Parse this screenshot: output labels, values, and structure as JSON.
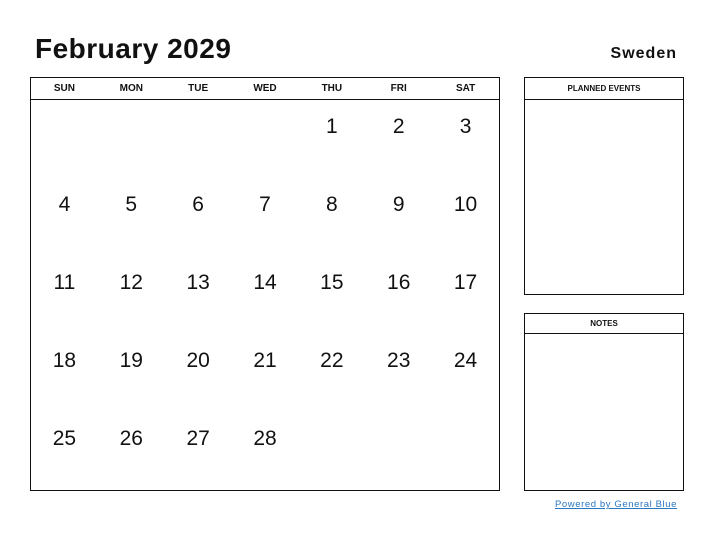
{
  "header": {
    "title": "February 2029",
    "country": "Sweden"
  },
  "calendar": {
    "weekdays": [
      "SUN",
      "MON",
      "TUE",
      "WED",
      "THU",
      "FRI",
      "SAT"
    ],
    "weeks": [
      [
        "",
        "",
        "",
        "",
        "1",
        "2",
        "3"
      ],
      [
        "4",
        "5",
        "6",
        "7",
        "8",
        "9",
        "10"
      ],
      [
        "11",
        "12",
        "13",
        "14",
        "15",
        "16",
        "17"
      ],
      [
        "18",
        "19",
        "20",
        "21",
        "22",
        "23",
        "24"
      ],
      [
        "25",
        "26",
        "27",
        "28",
        "",
        "",
        ""
      ]
    ]
  },
  "panels": {
    "planned_events": "PLANNED EVENTS",
    "notes": "NOTES"
  },
  "footer": {
    "powered_by": "Powered by General Blue",
    "link_color": "#2a78c2"
  }
}
